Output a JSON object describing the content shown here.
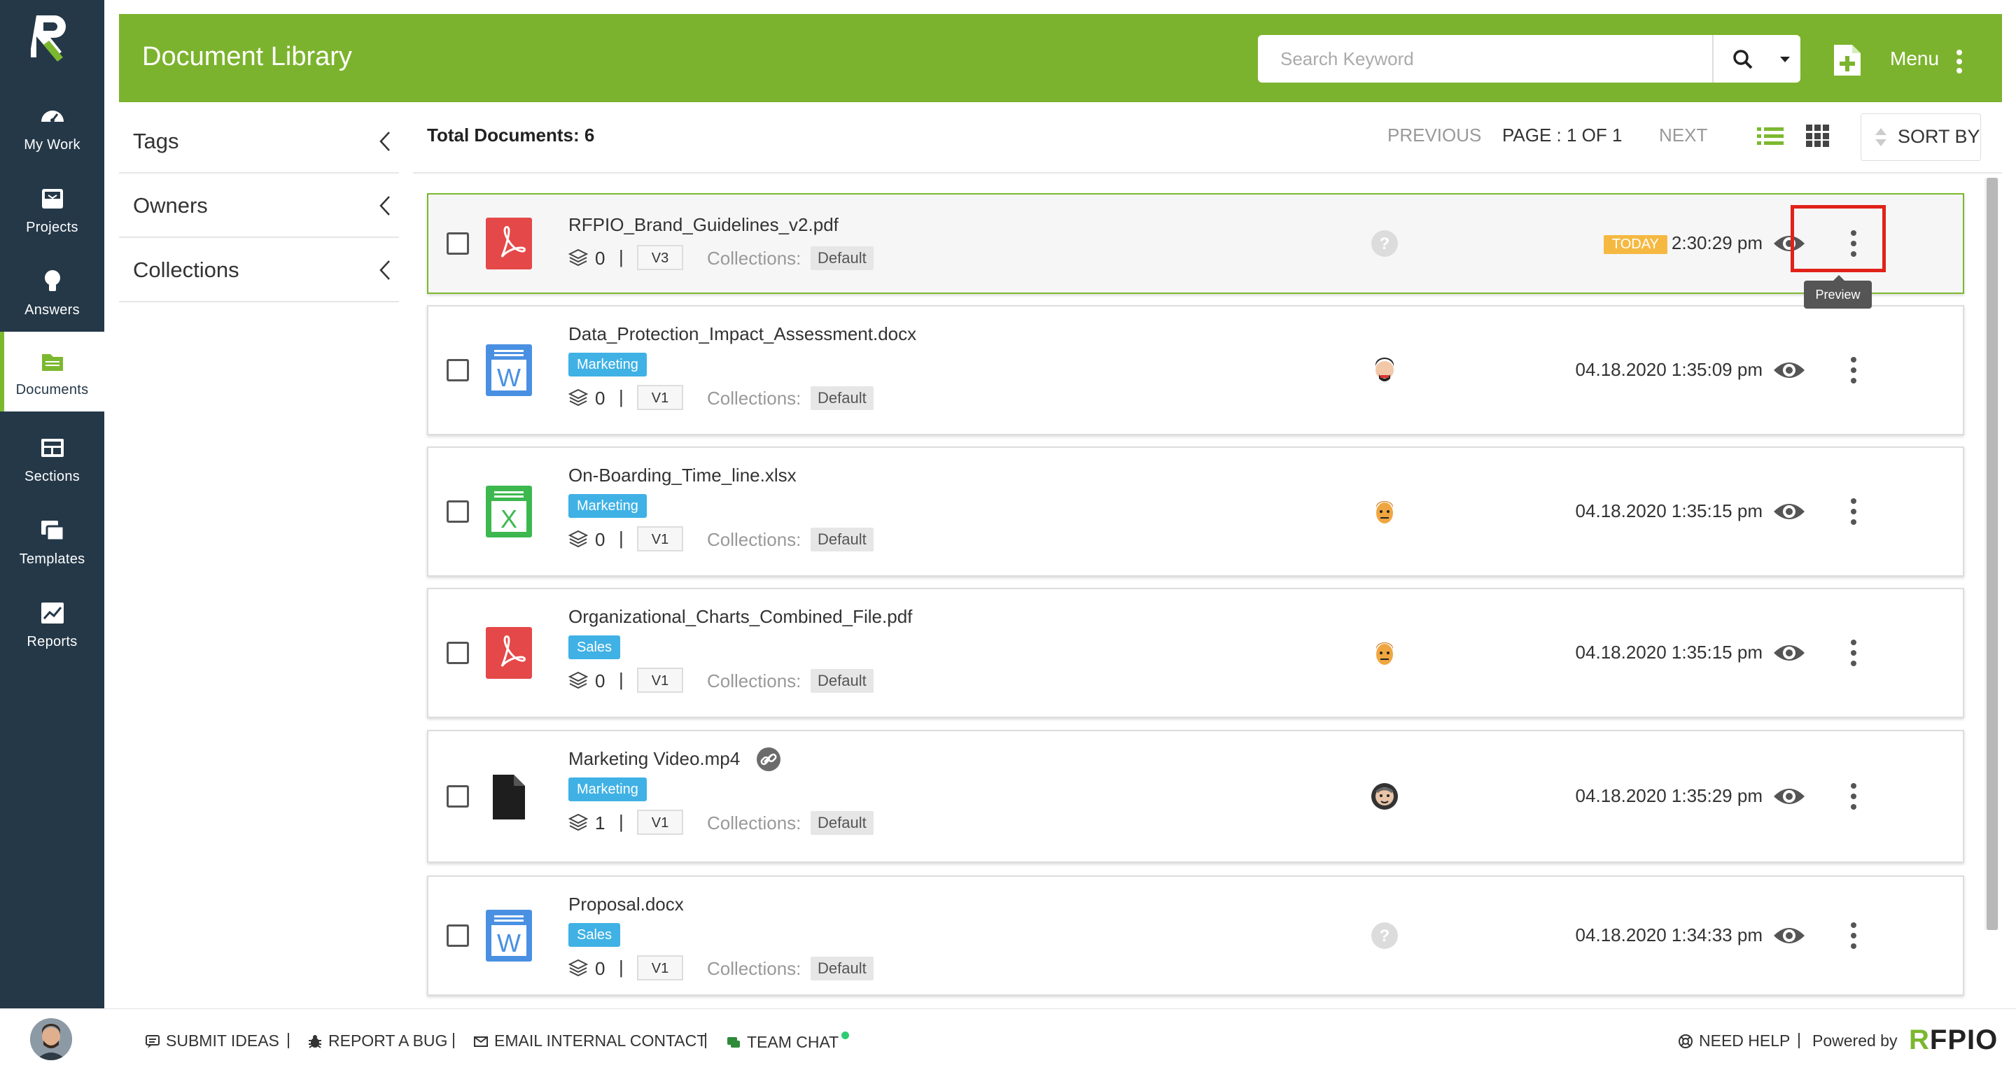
{
  "nav": {
    "items": [
      {
        "label": "My Work",
        "icon": "speedometer-icon"
      },
      {
        "label": "Projects",
        "icon": "inbox-icon"
      },
      {
        "label": "Answers",
        "icon": "lightbulb-icon"
      },
      {
        "label": "Documents",
        "icon": "folder-icon"
      },
      {
        "label": "Sections",
        "icon": "sections-icon"
      },
      {
        "label": "Templates",
        "icon": "templates-icon"
      },
      {
        "label": "Reports",
        "icon": "chart-icon"
      }
    ],
    "active": "Documents"
  },
  "header": {
    "title": "Document Library",
    "search_placeholder": "Search Keyword",
    "menu_label": "Menu"
  },
  "filters": [
    {
      "label": "Tags"
    },
    {
      "label": "Owners"
    },
    {
      "label": "Collections"
    }
  ],
  "toolbar": {
    "total_label": "Total Documents:",
    "total_count": "6",
    "previous": "PREVIOUS",
    "page_info": "PAGE : 1 OF 1",
    "next": "NEXT",
    "sort_label": "SORT BY"
  },
  "documents": [
    {
      "name": "RFPIO_Brand_Guidelines_v2.pdf",
      "type": "pdf",
      "tag": "",
      "count": "0",
      "version": "V3",
      "collections_label": "Collections:",
      "collection": "Default",
      "owner": "unknown",
      "today_badge": "TODAY",
      "timestamp": "2:30:29 pm"
    },
    {
      "name": "Data_Protection_Impact_Assessment.docx",
      "type": "docx",
      "tag": "Marketing",
      "count": "0",
      "version": "V1",
      "collections_label": "Collections:",
      "collection": "Default",
      "owner": "user-a",
      "timestamp": "04.18.2020 1:35:09 pm"
    },
    {
      "name": "On-Boarding_Time_line.xlsx",
      "type": "xlsx",
      "tag": "Marketing",
      "count": "0",
      "version": "V1",
      "collections_label": "Collections:",
      "collection": "Default",
      "owner": "user-b",
      "timestamp": "04.18.2020 1:35:15 pm"
    },
    {
      "name": "Organizational_Charts_Combined_File.pdf",
      "type": "pdf",
      "tag": "Sales",
      "count": "0",
      "version": "V1",
      "collections_label": "Collections:",
      "collection": "Default",
      "owner": "user-b",
      "timestamp": "04.18.2020 1:35:15 pm"
    },
    {
      "name": "Marketing Video.mp4",
      "type": "generic",
      "tag": "Marketing",
      "count": "1",
      "version": "V1",
      "collections_label": "Collections:",
      "collection": "Default",
      "owner": "user-c",
      "timestamp": "04.18.2020 1:35:29 pm"
    },
    {
      "name": "Proposal.docx",
      "type": "docx",
      "tag": "Sales",
      "count": "0",
      "version": "V1",
      "collections_label": "Collections:",
      "collection": "Default",
      "owner": "unknown",
      "timestamp": "04.18.2020 1:34:33 pm"
    }
  ],
  "tooltip": "Preview",
  "footer": {
    "submit_ideas": "SUBMIT IDEAS",
    "report_bug": "REPORT A BUG",
    "email_contact": "EMAIL INTERNAL CONTACT",
    "team_chat": "TEAM CHAT",
    "need_help": "NEED HELP",
    "powered_by": "Powered by",
    "brand": "RFPIO"
  },
  "colors": {
    "header": "#7cb32e",
    "sidebar": "#243848",
    "tag": "#3fb1e5",
    "today": "#f5b942",
    "highlight": "#e0231a"
  }
}
